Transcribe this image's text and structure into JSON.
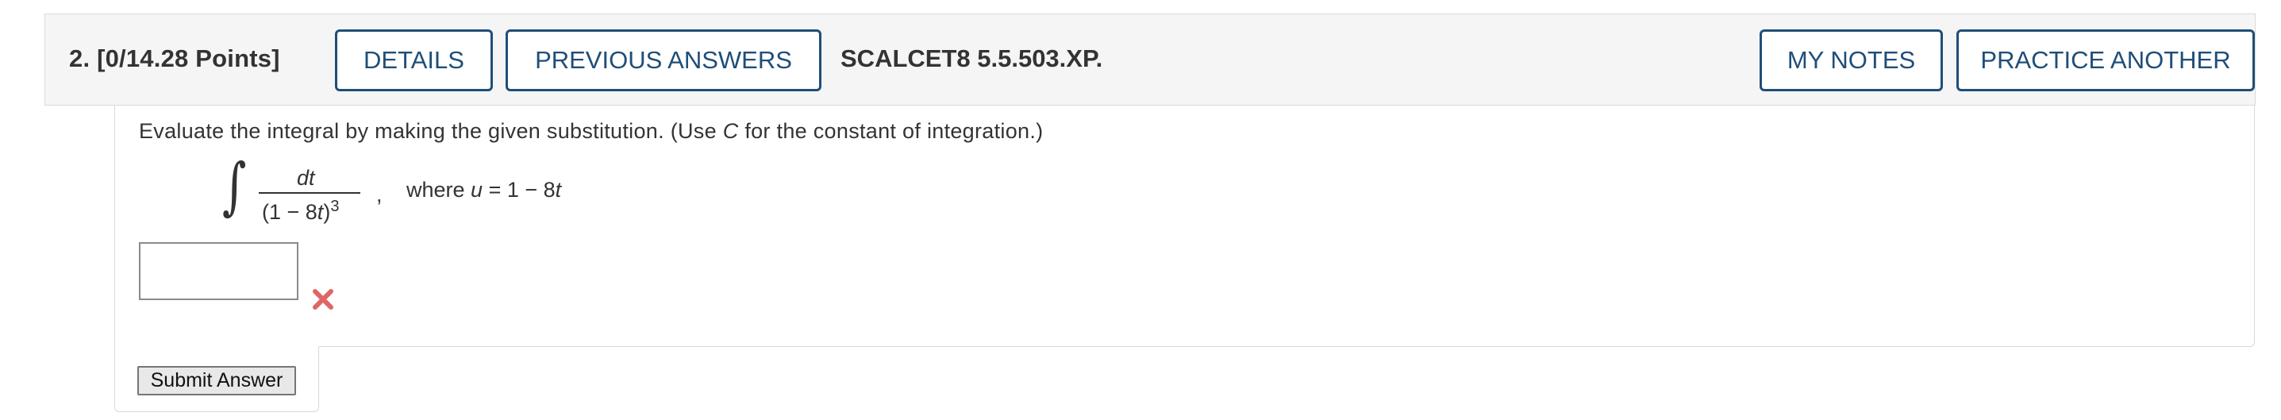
{
  "question": {
    "number_label": "2.",
    "points_label": "[0/14.28 Points]",
    "problem_code": "SCALCET8 5.5.503.XP."
  },
  "toolbar": {
    "details_label": "DETAILS",
    "previous_answers_label": "PREVIOUS ANSWERS",
    "my_notes_label": "MY NOTES",
    "practice_another_label": "PRACTICE ANOTHER"
  },
  "problem": {
    "instruction_before": "Evaluate the integral by making the given substitution. (Use ",
    "instruction_var": "C",
    "instruction_after": " for the constant of integration.)",
    "integral_sign": "∫",
    "numerator": "dt",
    "denominator_open": "(1 − 8",
    "denominator_var": "t",
    "denominator_close": ")",
    "denominator_exponent": "3",
    "separator": ",",
    "where_label": "where ",
    "sub_var": "u",
    "sub_rest": " = 1 − 8",
    "sub_t": "t"
  },
  "answer": {
    "value": "",
    "status": "incorrect",
    "status_icon": "x-mark-icon",
    "status_color": "#e06666"
  },
  "submit_label": "Submit Answer",
  "colors": {
    "button_border": "#1f4e79",
    "header_background": "#f5f5f5"
  }
}
